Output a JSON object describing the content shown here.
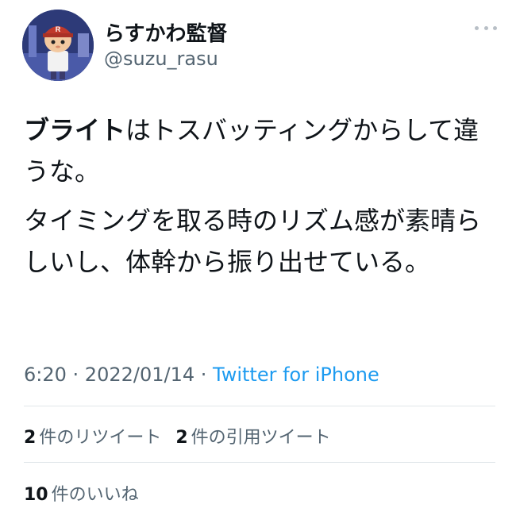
{
  "author": {
    "name": "らすかわ監督",
    "handle": "@suzu_rasu"
  },
  "tweet": {
    "line1_bold": "ブライト",
    "line1_rest": "はトスバッティングからして違うな。",
    "paragraph2": "タイミングを取る時のリズム感が素晴らしいし、体幹から振り出せている。"
  },
  "meta": {
    "time": "6:20",
    "sep1": " · ",
    "date": "2022/01/14",
    "sep2": " · ",
    "source": "Twitter for iPhone"
  },
  "stats": {
    "retweets_count": "2",
    "retweets_label": "件のリツイート",
    "quotes_count": "2",
    "quotes_label": "件の引用ツイート",
    "likes_count": "10",
    "likes_label": "件のいいね"
  }
}
